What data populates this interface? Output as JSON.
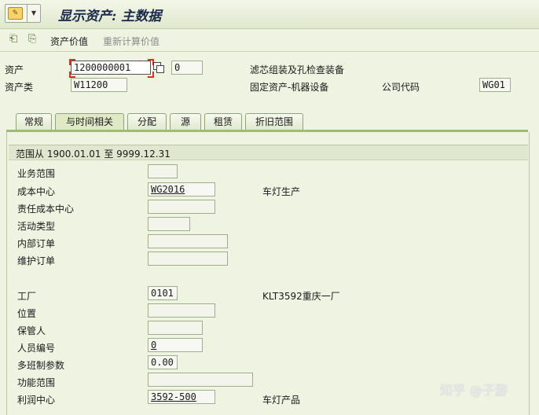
{
  "window": {
    "title": "显示资产: 主数据"
  },
  "toolbar": {
    "asset_value": "资产价值",
    "recalc_value": "重新计算价值"
  },
  "header": {
    "asset_label": "资产",
    "asset_number": "1200000001",
    "asset_sub": "0",
    "asset_desc": "滤芯组装及孔检查装备",
    "class_label": "资产类",
    "class_value": "W11200",
    "class_desc": "固定资产-机器设备",
    "company_label": "公司代码",
    "company_value": "WG01"
  },
  "tabs": [
    {
      "label": "常规"
    },
    {
      "label": "与时间相关",
      "active": true
    },
    {
      "label": "分配"
    },
    {
      "label": "源"
    },
    {
      "label": "租赁"
    },
    {
      "label": "折旧范围"
    }
  ],
  "range": "范围从 1900.01.01 至 9999.12.31",
  "fields": [
    {
      "label": "业务范围",
      "value": "",
      "desc": ""
    },
    {
      "label": "成本中心",
      "value": "WG2016",
      "desc": "车灯生产"
    },
    {
      "label": "责任成本中心",
      "value": "",
      "desc": ""
    },
    {
      "label": "活动类型",
      "value": "",
      "desc": ""
    },
    {
      "label": "内部订单",
      "value": "",
      "desc": ""
    },
    {
      "label": "维护订单",
      "value": "",
      "desc": ""
    },
    {
      "label": "工厂",
      "value": "0101",
      "desc": "KLT3592重庆一厂"
    },
    {
      "label": "位置",
      "value": "",
      "desc": ""
    },
    {
      "label": "保管人",
      "value": "",
      "desc": ""
    },
    {
      "label": "人员编号",
      "value": "0",
      "desc": ""
    },
    {
      "label": "多班制参数",
      "value": "0.00",
      "desc": ""
    },
    {
      "label": "功能范围",
      "value": "",
      "desc": ""
    },
    {
      "label": "利润中心",
      "value": "3592-500",
      "desc": "车灯产品"
    }
  ],
  "watermark": "知乎 @子游"
}
